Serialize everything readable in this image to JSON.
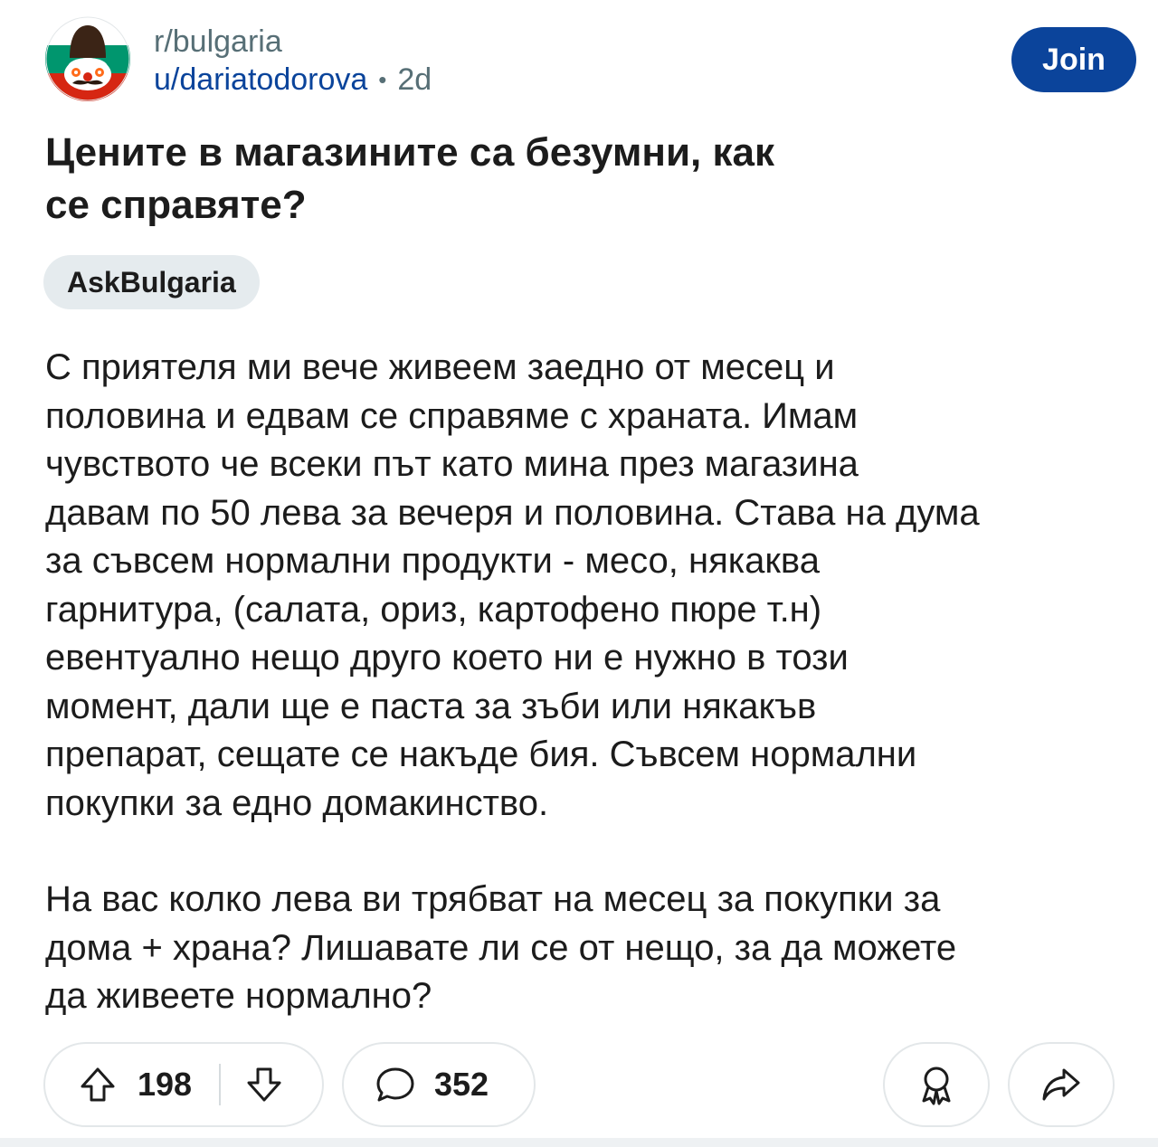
{
  "post": {
    "subreddit": "r/bulgaria",
    "author": "u/dariatodorova",
    "separator": "•",
    "age": "2d",
    "join_label": "Join",
    "title": "Цените в магазините са безумни, как\nсе справяте?",
    "flair": "AskBulgaria",
    "body_paragraph_1": "С приятеля ми вече живеем заедно от месец и\nполовина и едвам се справяме с храната. Имам\nчувството че всеки път като мина през магазина\nдавам по 50 лева за вечеря и половина. Става на дума\nза съвсем нормални продукти - месо, някаква\nгарнитура, (салата, ориз, картофено пюре т.н)\nевентуално нещо друго което ни е нужно в този\nмомент, дали ще е паста за зъби или някакъв\nпрепарат, сещате се накъде бия. Съвсем нормални\nпокупки за едно домакинство.",
    "body_paragraph_2": "На вас колко лева ви трябват на месец за покупки за\nдома + храна? Лишавате ли се от нещо, за да можете\nда живеете нормално?"
  },
  "actions": {
    "upvotes": "198",
    "comments": "352"
  },
  "icons": {
    "avatar": "bulgarian-flag-mascot-avatar",
    "upvote": "upvote-arrow-icon",
    "downvote": "downvote-arrow-icon",
    "comment": "comment-bubble-icon",
    "award": "award-icon",
    "share": "share-arrow-icon"
  },
  "colors": {
    "join_bg": "#0b449b",
    "username": "#0a449b",
    "flair_bg": "#e5ebee",
    "flag_white": "#ffffff",
    "flag_green": "#00966e",
    "flag_red": "#d62612"
  }
}
